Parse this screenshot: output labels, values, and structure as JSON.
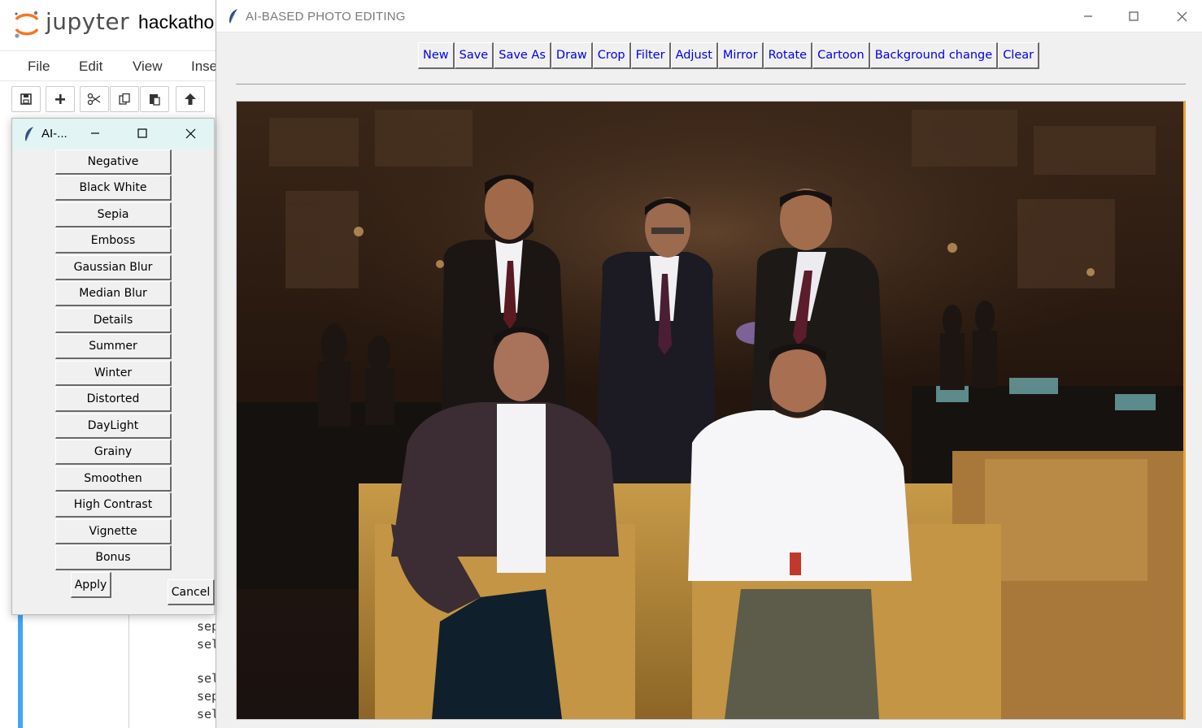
{
  "jupyter": {
    "logo_text": "jupyter",
    "notebook_name": "hackatho",
    "menu": [
      "File",
      "Edit",
      "View",
      "Inse"
    ],
    "toolbar_icons": [
      "save-icon",
      "plus-icon",
      "scissors-icon",
      "copy-icon",
      "paste-icon",
      "arrow-up-icon"
    ],
    "code_lines": [
      "sep",
      "sel",
      "",
      "sel",
      "sep",
      "sel"
    ]
  },
  "filter_window": {
    "title": "AI-...",
    "filters": [
      "Negative",
      "Black White",
      "Sepia",
      "Emboss",
      "Gaussian Blur",
      "Median Blur",
      "Details",
      "Summer",
      "Winter",
      "Distorted",
      "DayLight",
      "Grainy",
      "Smoothen",
      "High Contrast",
      "Vignette",
      "Bonus"
    ],
    "apply_label": "Apply",
    "cancel_label": "Cancel"
  },
  "main_window": {
    "title": "AI-BASED PHOTO EDITING",
    "toolbar": [
      "New",
      "Save",
      "Save As",
      "Draw",
      "Crop",
      "Filter",
      "Adjust",
      "Mirror",
      "Rotate",
      "Cartoon",
      "Background change",
      "Clear"
    ]
  },
  "colors": {
    "button_text": "#0000ee",
    "titlebar_small": "#e3f4f4",
    "window_bg": "#f0f0f0",
    "code_cell_bar": "#42a5f5"
  }
}
